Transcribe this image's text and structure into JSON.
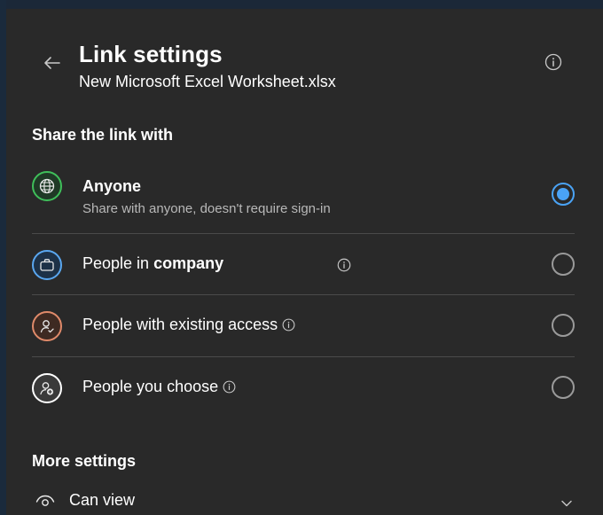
{
  "header": {
    "title": "Link settings",
    "file_name": "New Microsoft Excel Worksheet.xlsx"
  },
  "share_section": {
    "heading": "Share the link with",
    "options": [
      {
        "label": "Anyone",
        "description": "Share with anyone, doesn't require sign-in",
        "icon": "globe-icon",
        "icon_color": "#3fbf5a",
        "selected": true
      },
      {
        "label_prefix": "People in",
        "label_org": "company",
        "icon": "briefcase-icon",
        "icon_color": "#5aa7f0",
        "selected": false
      },
      {
        "label": "People with existing access",
        "icon": "person-check-icon",
        "icon_color": "#e08a6a",
        "selected": false
      },
      {
        "label": "People you choose",
        "icon": "person-add-icon",
        "icon_color": "#ffffff",
        "selected": false
      }
    ]
  },
  "more_section": {
    "heading": "More settings",
    "permission": "Can view"
  },
  "colors": {
    "panel_bg": "#292929",
    "accent": "#4aa3f5",
    "divider": "#4a4a4a"
  }
}
